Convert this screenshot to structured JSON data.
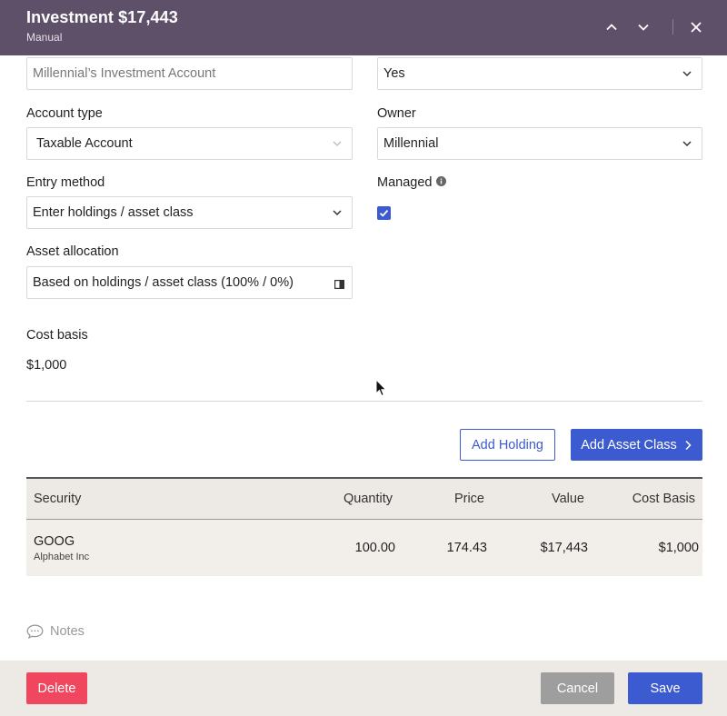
{
  "header": {
    "title": "Investment $17,443",
    "subtitle": "Manual",
    "icons": [
      "chevron-up-icon",
      "chevron-down-icon",
      "close-icon"
    ]
  },
  "form": {
    "account_name": {
      "placeholder": "Millennial’s Investment Account"
    },
    "top_right_select": {
      "value": "Yes"
    },
    "account_type": {
      "label": "Account type",
      "value": "Taxable Account"
    },
    "owner": {
      "label": "Owner",
      "value": "Millennial"
    },
    "entry_method": {
      "label": "Entry method",
      "value": "Enter holdings / asset class"
    },
    "managed": {
      "label": "Managed",
      "checked": true
    },
    "asset_allocation": {
      "label": "Asset allocation",
      "value": "Based on holdings / asset class (100% / 0%)"
    },
    "cost_basis": {
      "label": "Cost basis",
      "value": "$1,000"
    }
  },
  "actions": {
    "add_holding": "Add Holding",
    "add_asset_class": "Add Asset Class"
  },
  "table": {
    "columns": [
      "Security",
      "Quantity",
      "Price",
      "Value",
      "Cost Basis"
    ],
    "rows": [
      {
        "symbol": "GOOG",
        "name": "Alphabet Inc",
        "quantity": "100.00",
        "price": "174.43",
        "value": "$17,443",
        "cost_basis": "$1,000"
      }
    ]
  },
  "notes": {
    "label": "Notes"
  },
  "footer": {
    "delete": "Delete",
    "cancel": "Cancel",
    "save": "Save"
  },
  "colors": {
    "header_bg": "#5d5068",
    "primary": "#3d5bd0",
    "danger": "#f0475e",
    "cancel": "#9e9e9e"
  }
}
